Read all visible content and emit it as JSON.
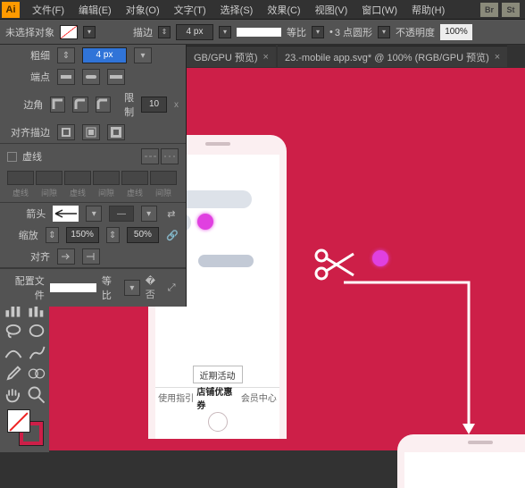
{
  "menubar": {
    "items": [
      "文件(F)",
      "编辑(E)",
      "对象(O)",
      "文字(T)",
      "选择(S)",
      "效果(C)",
      "视图(V)",
      "窗口(W)",
      "帮助(H)"
    ],
    "right_icons": [
      "Br",
      "St"
    ]
  },
  "ctrlbar": {
    "no_selection": "未选择对象",
    "stroke_label": "描边",
    "stroke_val": "4 px",
    "stroke_type": "等比",
    "brush_label": "3 点圆形",
    "opacity_label": "不透明度",
    "opacity_val": "100%"
  },
  "tabs": [
    {
      "label": "GB/GPU 预览)"
    },
    {
      "label": "23.-mobile app.svg* @ 100% (RGB/GPU 预览)"
    }
  ],
  "panel": {
    "weight_label": "粗细",
    "weight_val": "4 px",
    "cap_label": "端点",
    "corner_label": "边角",
    "limit_label": "限制",
    "limit_val": "10",
    "align_stroke": "对齐描边",
    "dashed": "虚线",
    "dash_labels": [
      "虚线",
      "间隙",
      "虚线",
      "间隙",
      "虚线",
      "间隙"
    ],
    "arrow_label": "箭头",
    "scale_label": "缩放",
    "scale_a": "150%",
    "scale_b": "50%",
    "align_label": "对齐",
    "profile_label": "配置文件",
    "profile_type": "等比"
  },
  "phone": {
    "cta": "近期活动",
    "tabs": [
      "使用指引",
      "店铺优惠券",
      "会员中心"
    ]
  }
}
